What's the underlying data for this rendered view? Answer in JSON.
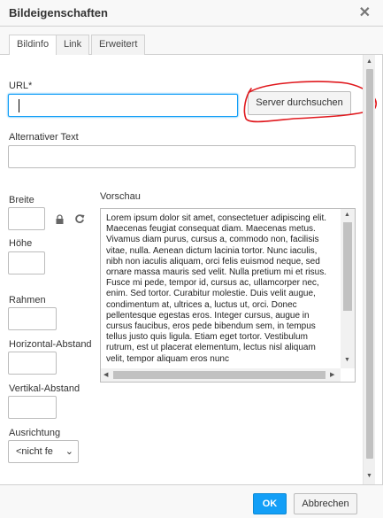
{
  "dialog": {
    "title": "Bildeigenschaften",
    "close_glyph": "✕"
  },
  "tabs": [
    {
      "label": "Bildinfo",
      "active": true
    },
    {
      "label": "Link",
      "active": false
    },
    {
      "label": "Erweitert",
      "active": false
    }
  ],
  "form": {
    "url_label": "URL*",
    "url_value": "",
    "browse_button": "Server durchsuchen",
    "alt_label": "Alternativer Text",
    "alt_value": "",
    "width_label": "Breite",
    "height_label": "Höhe",
    "border_label": "Rahmen",
    "hspace_label": "Horizontal-Abstand",
    "vspace_label": "Vertikal-Abstand",
    "align_label": "Ausrichtung",
    "align_value": "<nicht fe",
    "lock_icon": "lock-icon",
    "reset_icon": "reset-icon"
  },
  "preview": {
    "label": "Vorschau",
    "text": "Lorem ipsum dolor sit amet, consectetuer adipiscing elit. Maecenas feugiat consequat diam. Maecenas metus. Vivamus diam purus, cursus a, commodo non, facilisis vitae, nulla. Aenean dictum lacinia tortor. Nunc iaculis, nibh non iaculis aliquam, orci felis euismod neque, sed ornare massa mauris sed velit. Nulla pretium mi et risus. Fusce mi pede, tempor id, cursus ac, ullamcorper nec, enim. Sed tortor. Curabitur molestie. Duis velit augue, condimentum at, ultrices a, luctus ut, orci. Donec pellentesque egestas eros. Integer cursus, augue in cursus faucibus, eros pede bibendum sem, in tempus tellus justo quis ligula. Etiam eget tortor. Vestibulum rutrum, est ut placerat elementum, lectus nisl aliquam velit, tempor aliquam eros nunc"
  },
  "footer": {
    "ok": "OK",
    "cancel": "Abbrechen"
  },
  "colors": {
    "accent": "#139ff7",
    "annotation": "#e0191e"
  }
}
